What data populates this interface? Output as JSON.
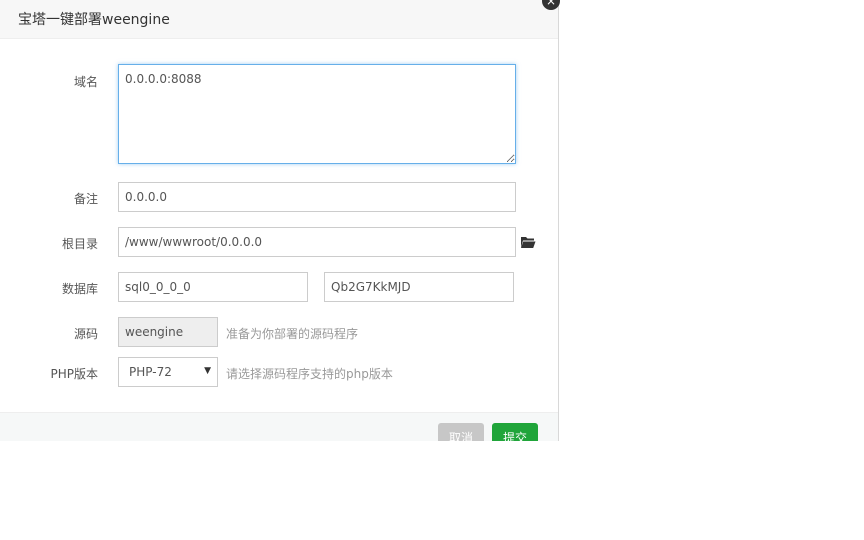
{
  "dialog": {
    "title": "宝塔一键部署weengine",
    "close_symbol": "×"
  },
  "form": {
    "domain": {
      "label": "域名",
      "value": "0.0.0.0:8088"
    },
    "remark": {
      "label": "备注",
      "value": "0.0.0.0"
    },
    "root_dir": {
      "label": "根目录",
      "value": "/www/wwwroot/0.0.0.0"
    },
    "database": {
      "label": "数据库",
      "name_value": "sql0_0_0_0",
      "password_value": "Qb2G7KkMJD"
    },
    "source": {
      "label": "源码",
      "value": "weengine",
      "hint": "准备为你部署的源码程序"
    },
    "php": {
      "label": "PHP版本",
      "selected": "PHP-72",
      "hint": "请选择源码程序支持的php版本"
    }
  },
  "footer": {
    "cancel_label": "取消",
    "submit_label": "提交"
  },
  "icons": {
    "folder": "folder-open-icon",
    "dropdown": "caret-down-icon"
  },
  "colors": {
    "submit": "#20a53a",
    "cancel": "#c7c7c7",
    "focus_border": "#66afe9"
  }
}
